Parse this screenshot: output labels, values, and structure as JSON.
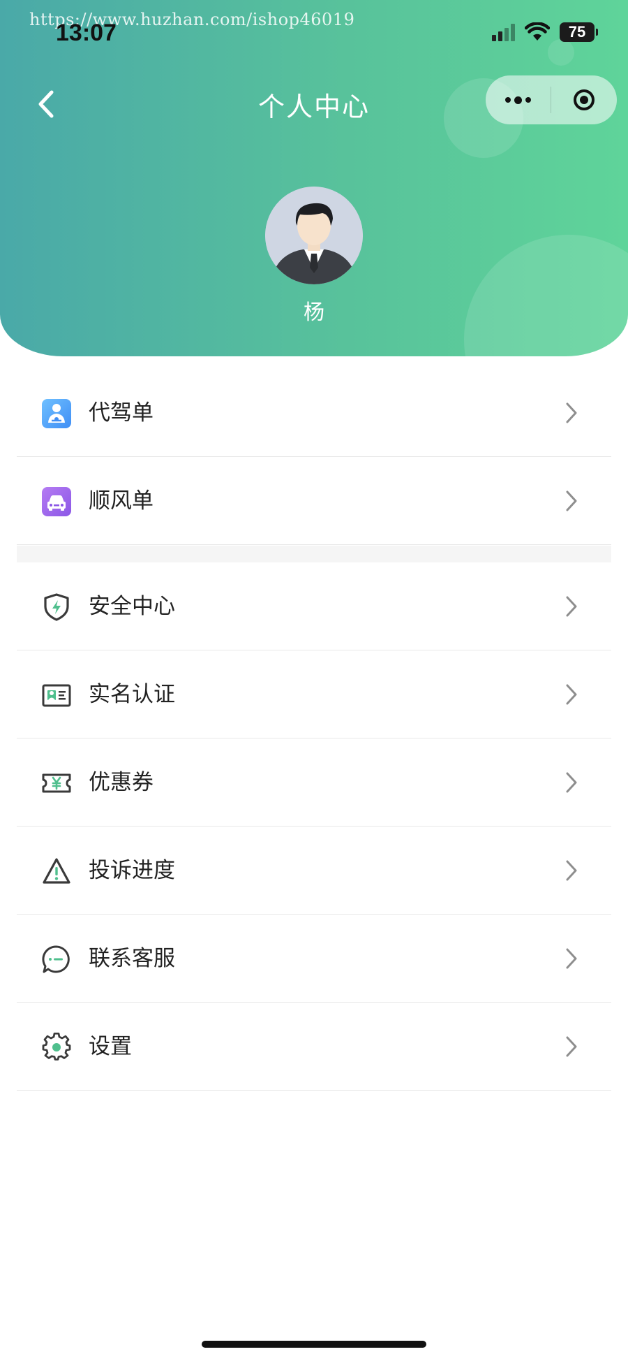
{
  "watermark": "https://www.huzhan.com/ishop46019",
  "status_bar": {
    "time": "13:07",
    "battery": "75"
  },
  "nav": {
    "title": "个人中心"
  },
  "profile": {
    "name": "杨"
  },
  "menu": {
    "orders": [
      {
        "label": "代驾单",
        "icon": "designated-driver-icon"
      },
      {
        "label": "顺风单",
        "icon": "car-icon"
      }
    ],
    "settings": [
      {
        "label": "安全中心",
        "icon": "shield-icon"
      },
      {
        "label": "实名认证",
        "icon": "id-card-icon"
      },
      {
        "label": "优惠券",
        "icon": "coupon-icon"
      },
      {
        "label": "投诉进度",
        "icon": "warning-icon"
      },
      {
        "label": "联系客服",
        "icon": "chat-icon"
      },
      {
        "label": "设置",
        "icon": "gear-icon"
      }
    ]
  },
  "colors": {
    "header_start": "#4aa9a8",
    "header_end": "#5fd49a",
    "accent": "#4fbf8d"
  }
}
